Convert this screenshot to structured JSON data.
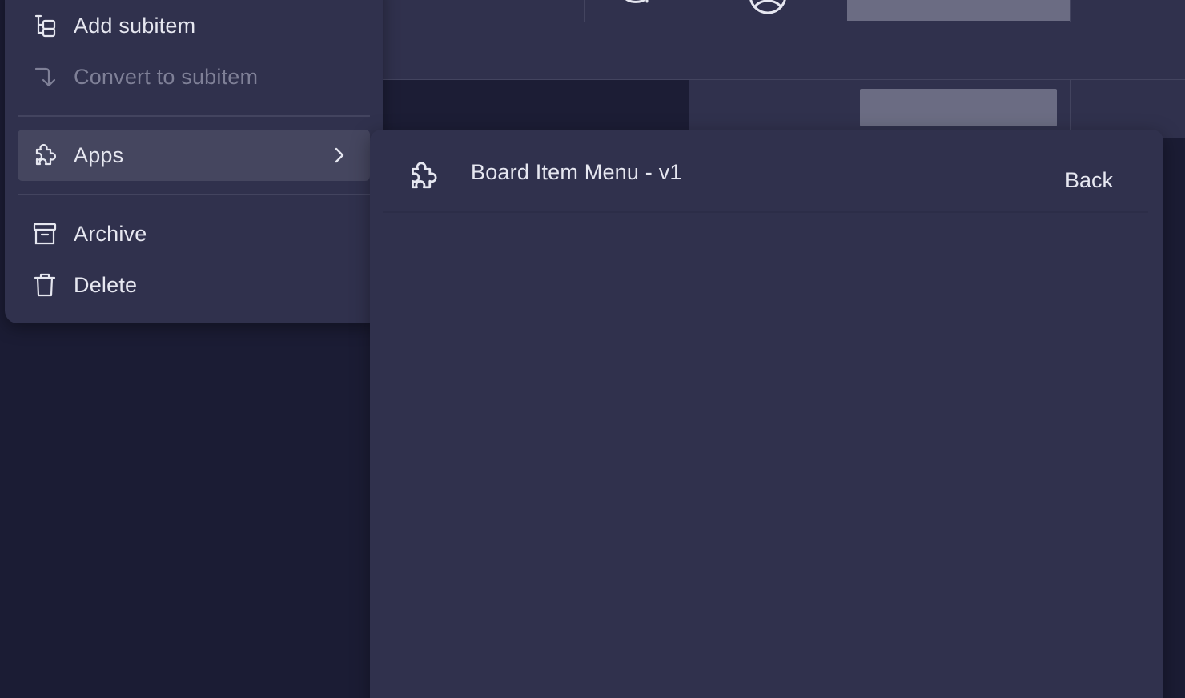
{
  "context_menu": {
    "items": [
      {
        "label": "Add subitem",
        "icon": "subitem-tree-icon",
        "enabled": true
      },
      {
        "label": "Convert to subitem",
        "icon": "convert-arrow-icon",
        "enabled": false
      },
      {
        "label": "Apps",
        "icon": "puzzle-icon",
        "enabled": true,
        "has_submenu": true
      },
      {
        "label": "Archive",
        "icon": "archive-box-icon",
        "enabled": true
      },
      {
        "label": "Delete",
        "icon": "trash-icon",
        "enabled": true
      }
    ]
  },
  "apps_submenu": {
    "app_name": "Board Item Menu - v1",
    "app_icon": "puzzle-icon",
    "back_label": "Back"
  },
  "colors": {
    "background": "#1b1c34",
    "surface": "#30314d",
    "hover": "#45465f",
    "text": "#e6e7f0",
    "text_disabled": "#7f8097",
    "status_gray": "#6b6c83"
  }
}
